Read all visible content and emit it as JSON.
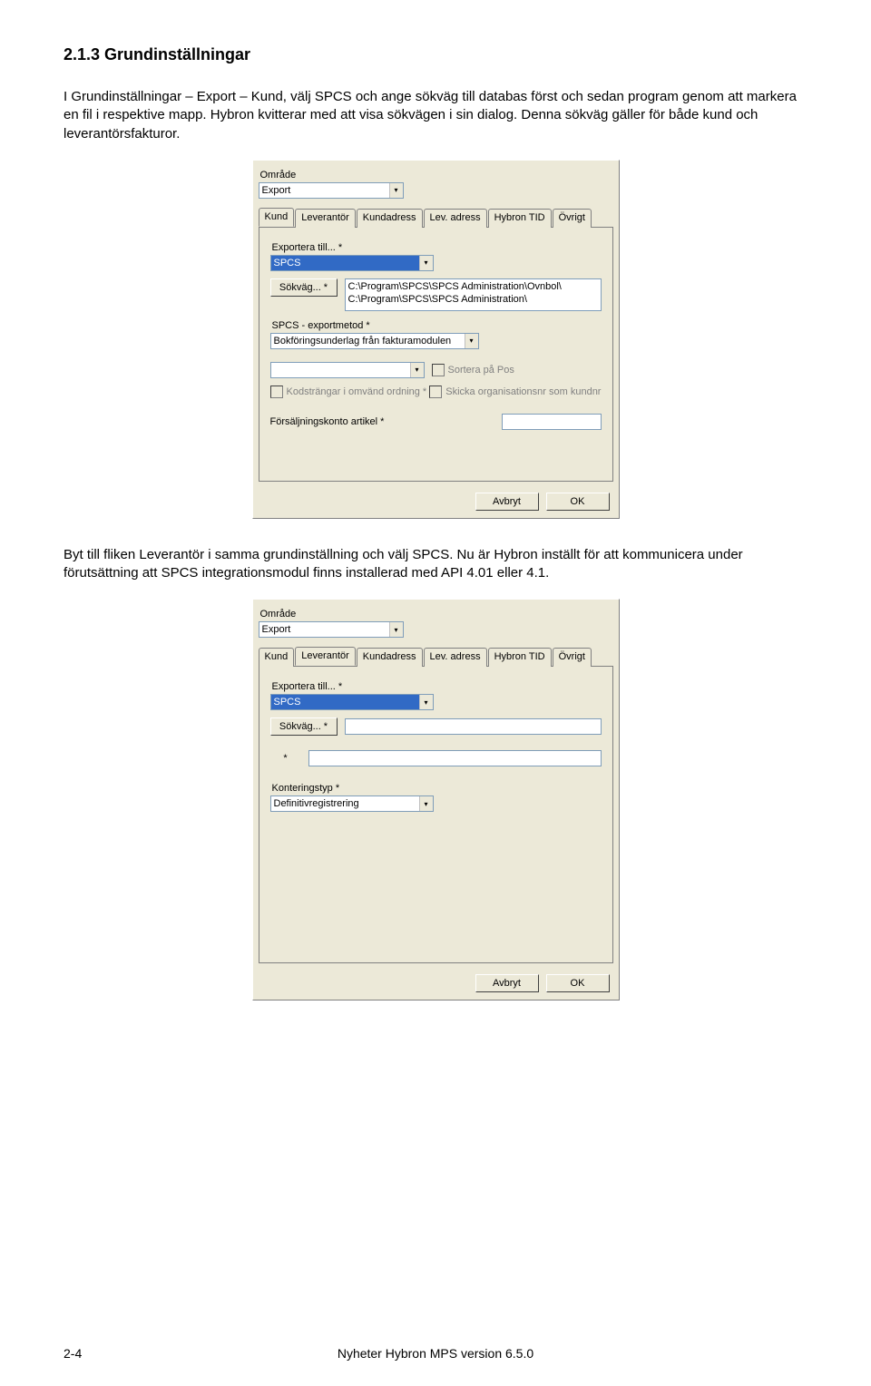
{
  "heading": "2.1.3   Grundinställningar",
  "para1": "I Grundinställningar – Export – Kund, välj SPCS och ange sökväg till databas först och sedan program genom att markera en fil i respektive mapp. Hybron kvitterar med att visa sökvägen i sin dialog. Denna sökväg gäller för både kund och leverantörsfakturor.",
  "para2": "Byt till fliken Leverantör i samma grundinställning och välj SPCS. Nu är Hybron inställt för att kommunicera under förutsättning att SPCS integrationsmodul finns installerad med API 4.01 eller 4.1.",
  "dialog1": {
    "omrade_label": "Område",
    "omrade_value": "Export",
    "tabs": [
      "Kund",
      "Leverantör",
      "Kundadress",
      "Lev. adress",
      "Hybron TID",
      "Övrigt"
    ],
    "active_tab": 0,
    "export_to_label": "Exportera till... *",
    "export_to_value": "SPCS",
    "sokvag_button": "Sökväg... *",
    "sokvag_line1": "C:\\Program\\SPCS\\SPCS Administration\\Ovnbol\\",
    "sokvag_line2": "C:\\Program\\SPCS\\SPCS Administration\\",
    "exportmetod_label": "SPCS - exportmetod *",
    "exportmetod_value": "Bokföringsunderlag från fakturamodulen",
    "sort_label": "Sortera på Pos",
    "chk1_label": "Kodsträngar i omvänd ordning *",
    "chk2_label": "Skicka organisationsnr som kundnr",
    "forsaljning_label": "Försäljningskonto artikel *",
    "btn_cancel": "Avbryt",
    "btn_ok": "OK"
  },
  "dialog2": {
    "omrade_label": "Område",
    "omrade_value": "Export",
    "tabs": [
      "Kund",
      "Leverantör",
      "Kundadress",
      "Lev. adress",
      "Hybron TID",
      "Övrigt"
    ],
    "active_tab": 1,
    "export_to_label": "Exportera till... *",
    "export_to_value": "SPCS",
    "sokvag_button": "Sökväg... *",
    "star": "*",
    "konteringstyp_label": "Konteringstyp *",
    "konteringstyp_value": "Definitivregistrering",
    "btn_cancel": "Avbryt",
    "btn_ok": "OK"
  },
  "footer": {
    "page_number": "2-4",
    "title": "Nyheter Hybron MPS version 6.5.0"
  }
}
